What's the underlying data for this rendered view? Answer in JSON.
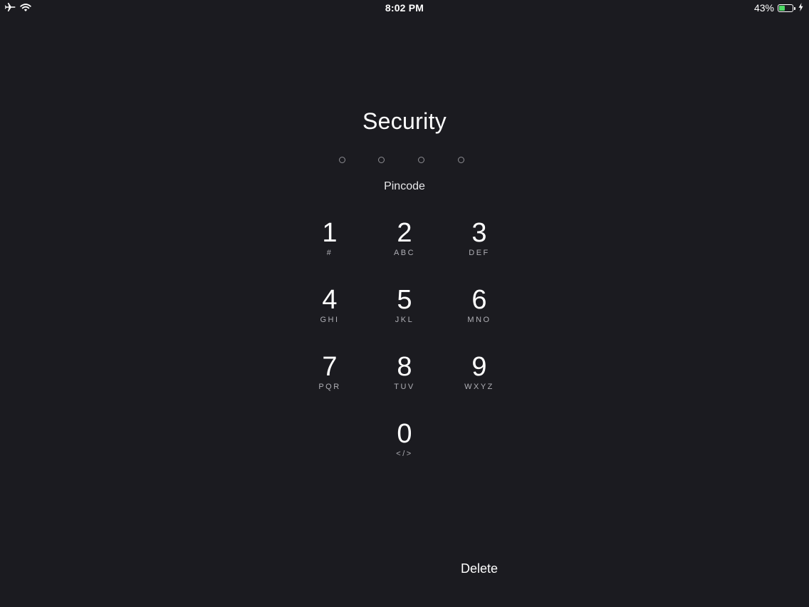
{
  "status_bar": {
    "time": "8:02 PM",
    "battery_percent_text": "43%",
    "battery_level": 0.43,
    "battery_color": "#4cd964",
    "icons": [
      "airplane-icon",
      "wifi-icon",
      "battery-icon",
      "charging-bolt-icon"
    ]
  },
  "screen": {
    "title": "Security",
    "pin_length": 4,
    "pin_entered": 0,
    "pincode_label": "Pincode",
    "delete_label": "Delete"
  },
  "keypad": {
    "keys": [
      {
        "digit": "1",
        "letters": "#"
      },
      {
        "digit": "2",
        "letters": "ABC"
      },
      {
        "digit": "3",
        "letters": "DEF"
      },
      {
        "digit": "4",
        "letters": "GHI"
      },
      {
        "digit": "5",
        "letters": "JKL"
      },
      {
        "digit": "6",
        "letters": "MNO"
      },
      {
        "digit": "7",
        "letters": "PQR"
      },
      {
        "digit": "8",
        "letters": "TUV"
      },
      {
        "digit": "9",
        "letters": "WXYZ"
      },
      {
        "digit": "0",
        "letters": "</>"
      }
    ]
  },
  "colors": {
    "background": "#1b1b20",
    "dot_outline": "#8e8e93",
    "text": "#ffffff"
  }
}
